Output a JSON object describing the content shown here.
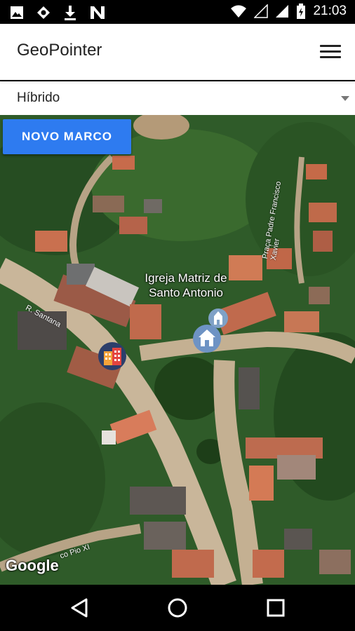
{
  "status_bar": {
    "time": "21:03",
    "icons": [
      "image-icon",
      "location-target-icon",
      "download-icon",
      "n-app-icon",
      "wifi-icon",
      "signal-empty-icon",
      "signal-icon",
      "battery-charging-icon"
    ]
  },
  "app_bar": {
    "title": "GeoPointer",
    "menu_icon": "hamburger-menu-icon"
  },
  "map_type": {
    "selected": "Híbrido"
  },
  "map": {
    "new_mark_button": "NOVO MARCO",
    "place_label_line1": "Igreja Matriz de",
    "place_label_line2": "Santo Antonio",
    "street_labels": [
      "R. Santana",
      "Praça Padre Francisco Xavier",
      "co Pio XI"
    ],
    "attribution": "Google",
    "markers": [
      "church-marker-icon",
      "home-marker-icon",
      "building-marker-icon"
    ]
  },
  "nav_bar": {
    "buttons": [
      "back-icon",
      "home-icon",
      "recents-icon"
    ]
  }
}
